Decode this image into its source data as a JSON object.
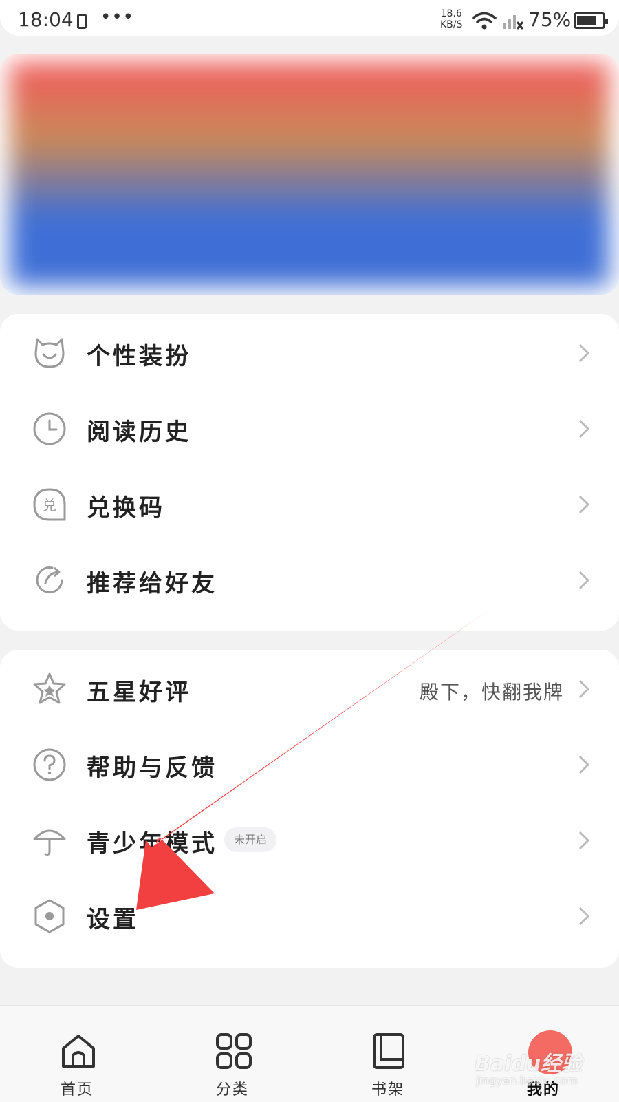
{
  "status_bar": {
    "time": "18:04",
    "dots": "•••",
    "speed_value": "18.6",
    "speed_unit": "KB/S",
    "battery": "75%",
    "battery_level": 0.75
  },
  "banner": {
    "colors": [
      "#f25a5a",
      "#3f6fd6",
      "#9fd6e8"
    ]
  },
  "menu_group_1": [
    {
      "label": "个性装扮",
      "icon": "cat-face-icon"
    },
    {
      "label": "阅读历史",
      "icon": "clock-icon"
    },
    {
      "label": "兑换码",
      "icon": "coupon-icon"
    },
    {
      "label": "推荐给好友",
      "icon": "share-icon"
    }
  ],
  "menu_group_2": [
    {
      "label": "五星好评",
      "icon": "star-icon",
      "hint": "殿下，快翻我牌"
    },
    {
      "label": "帮助与反馈",
      "icon": "question-icon"
    },
    {
      "label": "青少年模式",
      "icon": "umbrella-icon",
      "badge": "未开启"
    },
    {
      "label": "设置",
      "icon": "settings-hexagon-icon"
    }
  ],
  "nav": [
    {
      "label": "首页",
      "icon": "home-icon",
      "active": false
    },
    {
      "label": "分类",
      "icon": "grid-icon",
      "active": false
    },
    {
      "label": "书架",
      "icon": "book-icon",
      "active": false
    },
    {
      "label": "我的",
      "icon": "profile-icon",
      "active": true
    }
  ],
  "watermark": {
    "main": "Baidu经验",
    "sub": "jingyan.baidu.com"
  },
  "colors": {
    "arrow": "#f24040",
    "accent": "#f46b63",
    "icon_gray": "#9a9a9a"
  }
}
